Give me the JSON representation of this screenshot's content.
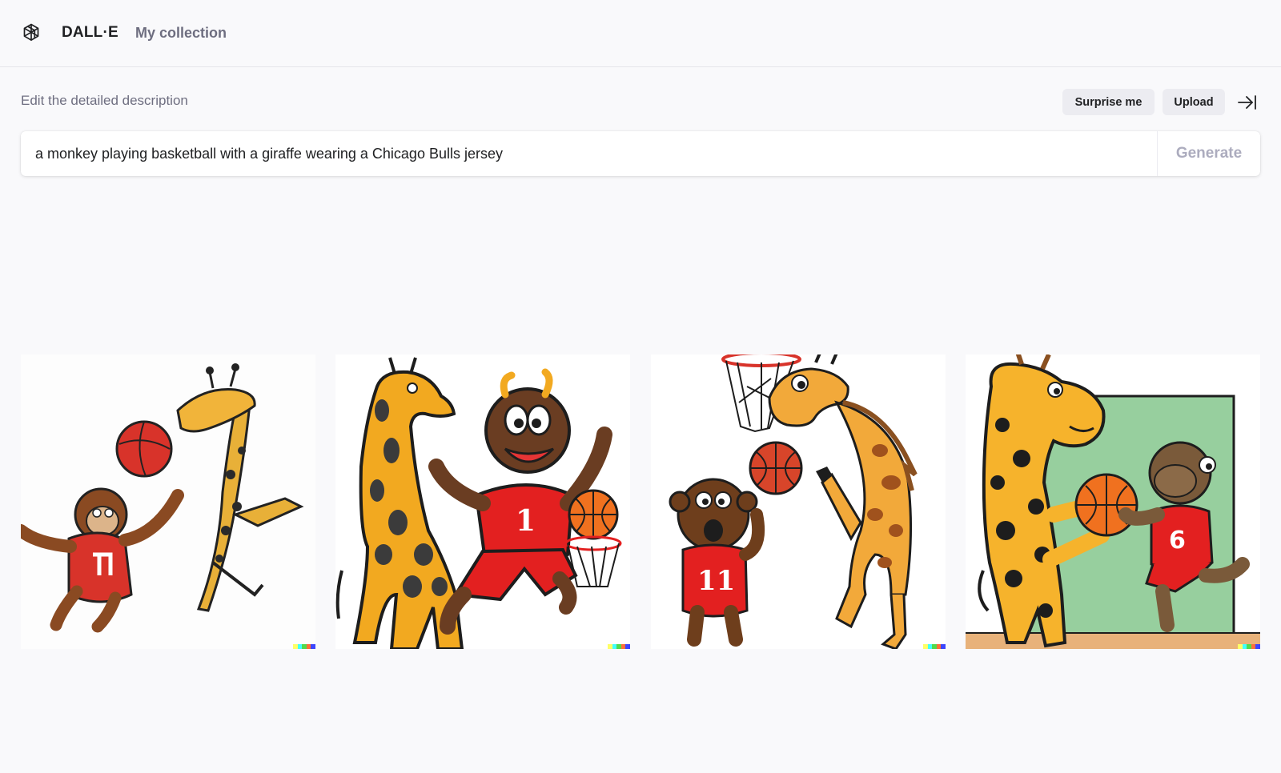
{
  "header": {
    "brand": "DALL·E",
    "nav_collection": "My collection",
    "logo_icon": "openai-logo-icon"
  },
  "prompt": {
    "label": "Edit the detailed description",
    "value": "a monkey playing basketball with a giraffe wearing a Chicago Bulls jersey",
    "generate_label": "Generate",
    "surprise_label": "Surprise me",
    "upload_label": "Upload",
    "collapse_icon": "arrow-right-bar-icon"
  },
  "results": {
    "count": 4,
    "signature_colors": [
      "#ffff66",
      "#42ffff",
      "#51da4c",
      "#ff6e3c",
      "#3c46ff"
    ]
  },
  "colors": {
    "background": "#f9f9fb",
    "text": "#202123",
    "muted": "#6e6e80",
    "button_bg": "#ececf1",
    "generate_disabled": "#acacbe"
  }
}
